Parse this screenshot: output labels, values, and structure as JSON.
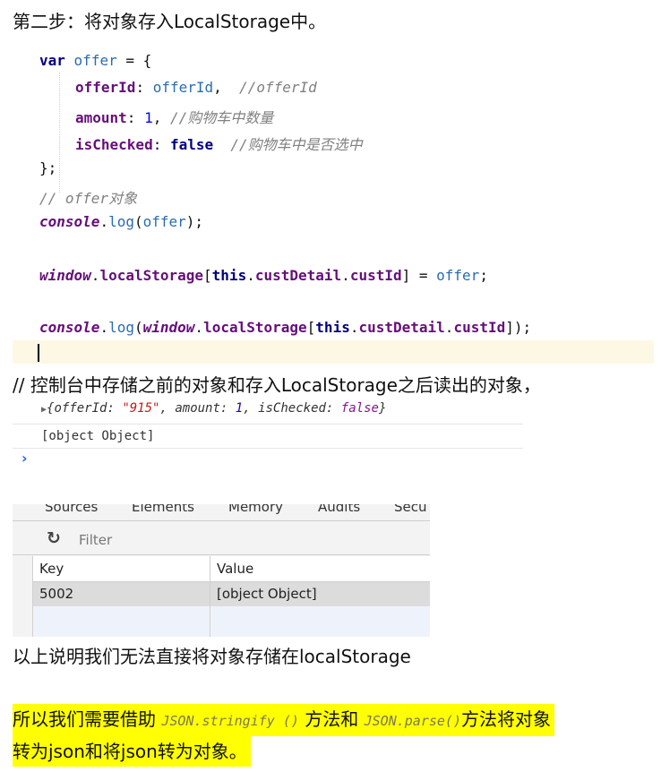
{
  "heading_step2": "第二步：将对象存入LocalStorage中。",
  "code": {
    "line1_kw": "var",
    "line1_var": "offer",
    "line1_rest": " = {",
    "line2_prop": "offerId",
    "line2_val": "offerId",
    "line2_comment": "//offerId",
    "line3_prop": "amount",
    "line3_num": "1",
    "line3_comment": "//购物车中数量",
    "line4_prop": "isChecked",
    "line4_val": "false",
    "line4_comment": "//购物车中是否选中",
    "line5": "};",
    "line6_comment": "// offer对象",
    "line7_obj": "console",
    "line7_fn": "log",
    "line7_arg": "offer",
    "line8_obj": "window",
    "line8_prop": "localStorage",
    "line8_this": "this",
    "line8_path": "custDetail",
    "line8_key": "custId",
    "line8_val": "offer",
    "line9_obj": "console",
    "line9_fn": "log",
    "line9_win": "window",
    "line9_prop": "localStorage",
    "line9_this": "this",
    "line9_path": "custDetail",
    "line9_key": "custId"
  },
  "heading_console": "// 控制台中存储之前的对象和存入LocalStorage之后读出的对象，",
  "console": {
    "line1_open": "{offerId: ",
    "line1_str": "\"915\"",
    "line1_mid": ", amount: ",
    "line1_num": "1",
    "line1_mid2": ", isChecked: ",
    "line1_bool": "false",
    "line1_close": "}",
    "line2": "[object Object]",
    "prompt": "›"
  },
  "devtools": {
    "tabs": [
      "Sources",
      "Elements",
      "Memory",
      "Audits",
      "Secu"
    ],
    "filter_placeholder": "Filter",
    "columns": [
      "Key",
      "Value"
    ],
    "rows": [
      {
        "key": "5002",
        "value": "[object Object]"
      }
    ]
  },
  "text_conclusion": "以上说明我们无法直接将对象存储在localStorage",
  "highlight": {
    "part1": "所以我们需要借助 ",
    "code1": "JSON.stringify ()",
    "part2": " 方法和 ",
    "code2": "JSON.parse()",
    "part3": "方法将对象",
    "line2": "转为json和将json转为对象。",
    "color": "#ffff00"
  },
  "colors": {
    "code_bg": "#ffffff",
    "cursor_line_bg": "#fcf8e3",
    "table_selected": "#dcdcdc"
  }
}
